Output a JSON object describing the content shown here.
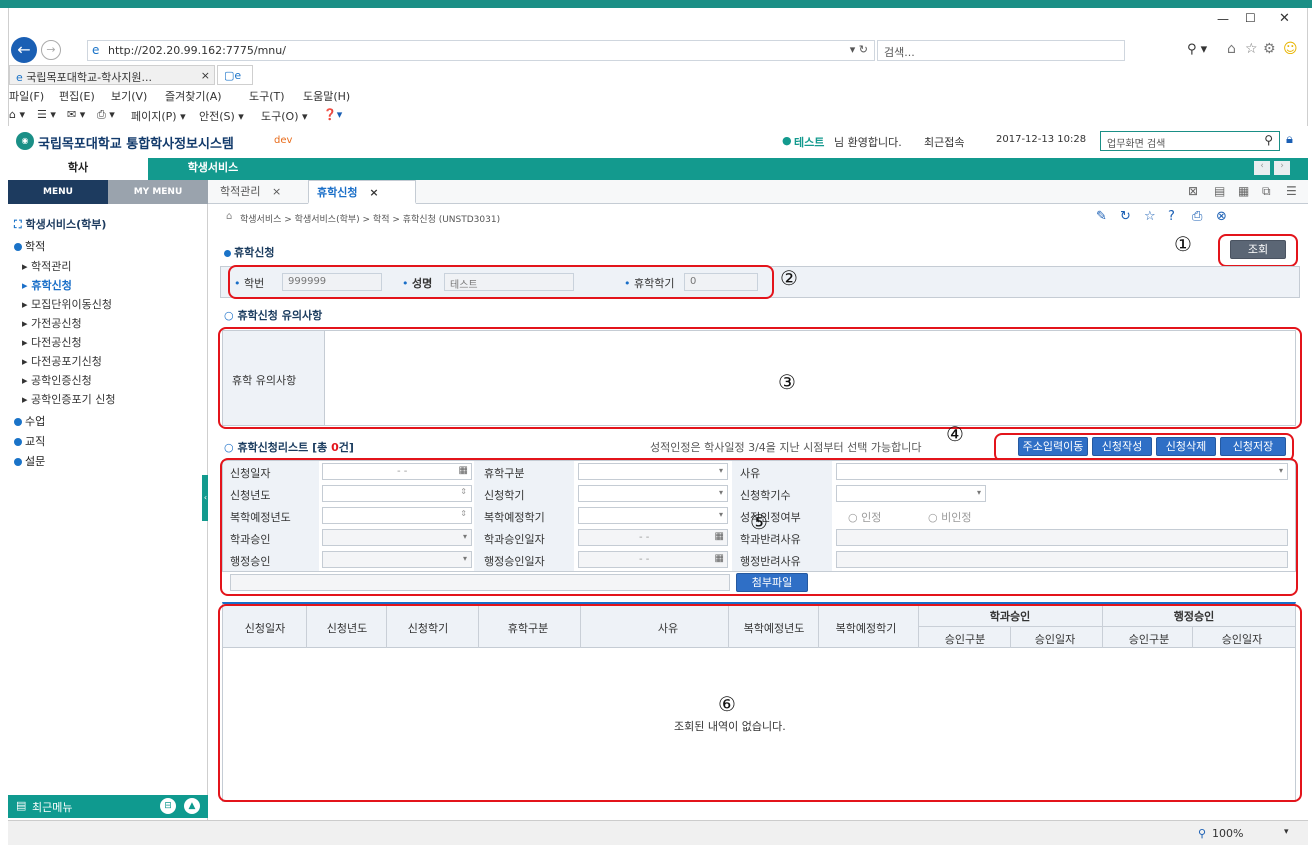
{
  "browser": {
    "url": "http://202.20.99.162:7775/mnu/",
    "search_placeholder": "검색...",
    "tab_title": "국립목포대학교-학사지원...",
    "menu": [
      "파일(F)",
      "편집(E)",
      "보기(V)",
      "즐겨찾기(A)",
      "도구(T)",
      "도움말(H)"
    ],
    "cmd_page": "페이지(P) ▾",
    "cmd_safety": "안전(S) ▾",
    "cmd_tools": "도구(O) ▾",
    "zoom": "100%"
  },
  "app": {
    "title": "국립목포대학교 통합학사정보시스템",
    "env": "dev",
    "user_name": "테스트",
    "welcome": "님 환영합니다.",
    "last_access_label": "최근접속",
    "last_access": "2017-12-13 10:28",
    "search_placeholder": "업무화면 검색",
    "nav": [
      "학사",
      "학생서비스"
    ]
  },
  "sidebar": {
    "tabs": [
      "MENU",
      "MY MENU"
    ],
    "root": "학생서비스(학부)",
    "folder_haekjeok": "학적",
    "items": [
      "학적관리",
      "휴학신청",
      "모집단위이동신청",
      "가전공신청",
      "다전공신청",
      "다전공포기신청",
      "공학인증신청",
      "공학인증포기 신청"
    ],
    "folders": [
      "수업",
      "교직",
      "설문"
    ],
    "footer": "최근메뉴"
  },
  "content": {
    "tabs": [
      "학적관리",
      "휴학신청"
    ],
    "breadcrumb": "학생서비스 > 학생서비스(학부) > 학적 > 휴학신청 (UNSTD3031)",
    "section1": "휴학신청",
    "search_button": "조회",
    "student_id_label": "학번",
    "student_id": "999999",
    "name_label": "성명",
    "name": "테스트",
    "semesters_label": "휴학학기",
    "semesters": "0",
    "notice_section": "휴학신청 유의사항",
    "notice_label": "휴학 유의사항",
    "list_section": "휴학신청리스트 [총",
    "list_count": "0",
    "list_suffix": "건]",
    "grade_notice": "성적인정은 학사일정 3/4을 지난 시점부터 선택 가능합니다",
    "buttons": [
      "주소입력이동",
      "신청작성",
      "신청삭제",
      "신청저장"
    ],
    "form": {
      "apply_date": "신청일자",
      "date_dash": "-  -",
      "leave_type": "휴학구분",
      "reason": "사유",
      "apply_year": "신청년도",
      "apply_term": "신청학기",
      "apply_terms": "신청학기수",
      "return_year": "복학예정년도",
      "return_term": "복학예정학기",
      "grade_ok": "성적인정여부",
      "recognize": "인정",
      "not_recognize": "비인정",
      "dept_approve": "학과승인",
      "dept_approve_date": "학과승인일자",
      "dept_reject": "학과반려사유",
      "admin_approve": "행정승인",
      "admin_approve_date": "행정승인일자",
      "admin_reject": "행정반려사유",
      "attach": "첨부파일"
    },
    "table": {
      "cols": [
        "신청일자",
        "신청년도",
        "신청학기",
        "휴학구분",
        "사유",
        "복학예정년도",
        "복학예정학기"
      ],
      "group1": "학과승인",
      "group2": "행정승인",
      "sub": [
        "승인구분",
        "승인일자",
        "승인구분",
        "승인일자"
      ],
      "empty": "조회된 내역이 없습니다."
    }
  },
  "annotations": [
    "①",
    "②",
    "③",
    "④",
    "⑤",
    "⑥"
  ]
}
